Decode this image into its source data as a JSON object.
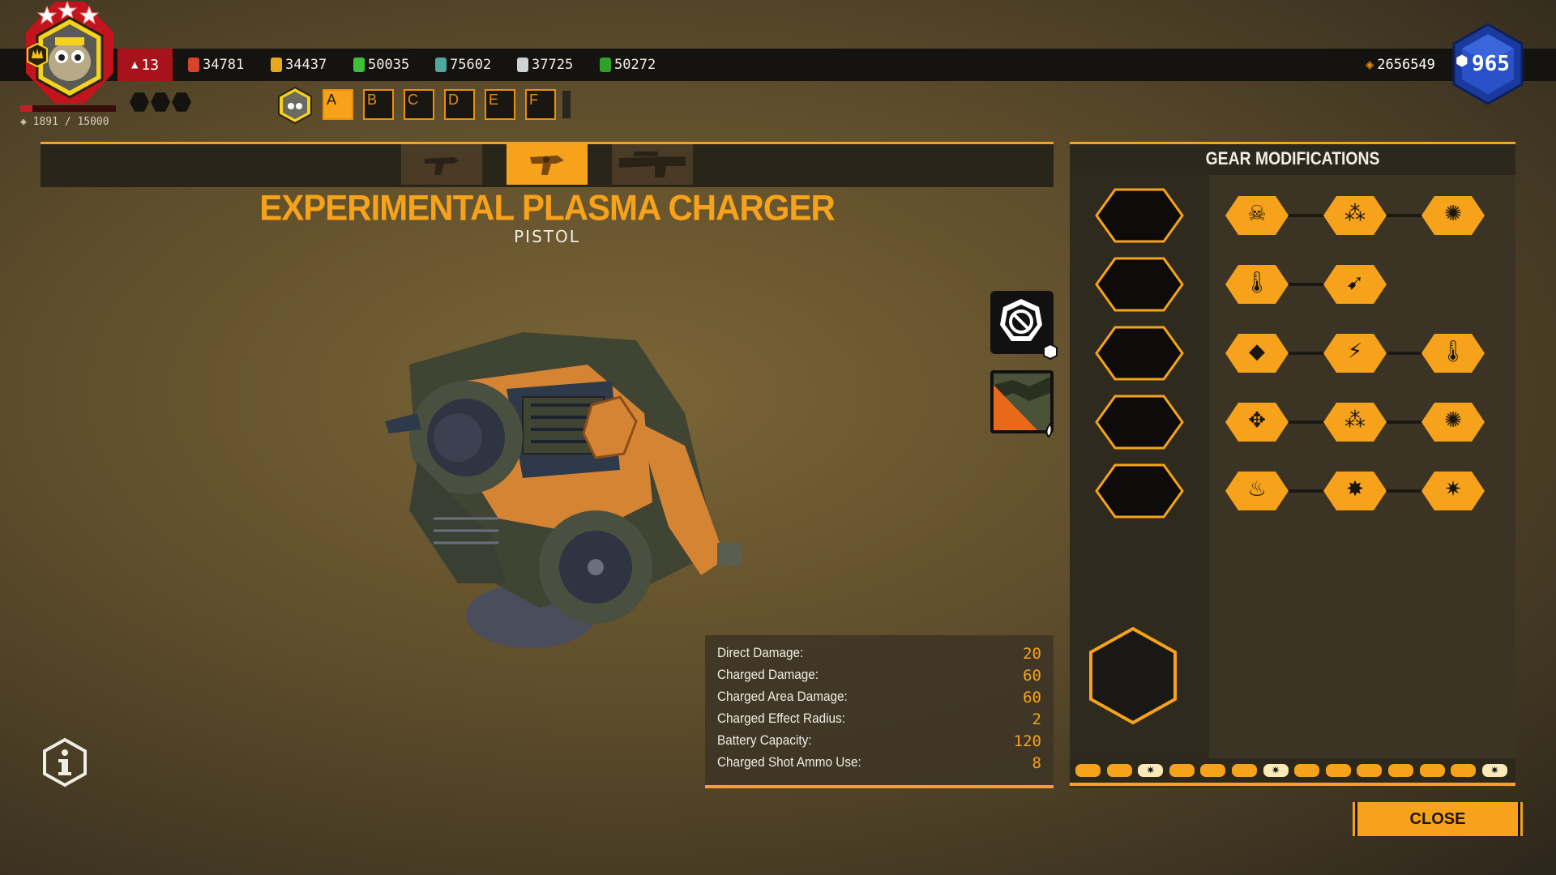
{
  "player": {
    "rank": "13",
    "xp_text": "1891 / 15000",
    "xp_progress": 0.126,
    "level": "965",
    "credits": "2656549"
  },
  "resources": [
    {
      "icon": "red-crystal-icon",
      "value": "34781",
      "color": "#d9432a"
    },
    {
      "icon": "gold-ore-icon",
      "value": "34437",
      "color": "#e8a81c"
    },
    {
      "icon": "green-gem-icon",
      "value": "50035",
      "color": "#3fbf3a"
    },
    {
      "icon": "teal-crystal-icon",
      "value": "75602",
      "color": "#4fa8a0"
    },
    {
      "icon": "silver-ore-icon",
      "value": "37725",
      "color": "#cfd3d6"
    },
    {
      "icon": "green-shard-icon",
      "value": "50272",
      "color": "#2fa02a"
    }
  ],
  "loadout_slots": [
    "A",
    "B",
    "C",
    "D",
    "E",
    "F"
  ],
  "weapon": {
    "name": "EXPERIMENTAL PLASMA CHARGER",
    "type": "PISTOL"
  },
  "stats": [
    {
      "label": "Direct Damage:",
      "value": "20"
    },
    {
      "label": "Charged Damage:",
      "value": "60"
    },
    {
      "label": "Charged Area Damage:",
      "value": "60"
    },
    {
      "label": "Charged Effect Radius:",
      "value": "2"
    },
    {
      "label": "Battery Capacity:",
      "value": "120"
    },
    {
      "label": "Charged Shot Ammo Use:",
      "value": "8"
    }
  ],
  "gear": {
    "title": "GEAR MODIFICATIONS",
    "rows": [
      [
        "skull-icon",
        "bullets-icon",
        "reticle-icon"
      ],
      [
        "temperature-down-icon",
        "fast-projectile-icon"
      ],
      [
        "ore-chunk-icon",
        "lightning-up-icon",
        "temperature-down-icon"
      ],
      [
        "crosshair-move-icon",
        "bullets-icon",
        "reticle-icon"
      ],
      [
        "fire-icon",
        "burst-icon",
        "explosion-icon"
      ]
    ]
  },
  "close_label": "CLOSE",
  "colors": {
    "accent": "#f7a21b",
    "dark": "#1a1712",
    "rank_red": "#a8121a",
    "level_blue": "#1a3fa8"
  }
}
